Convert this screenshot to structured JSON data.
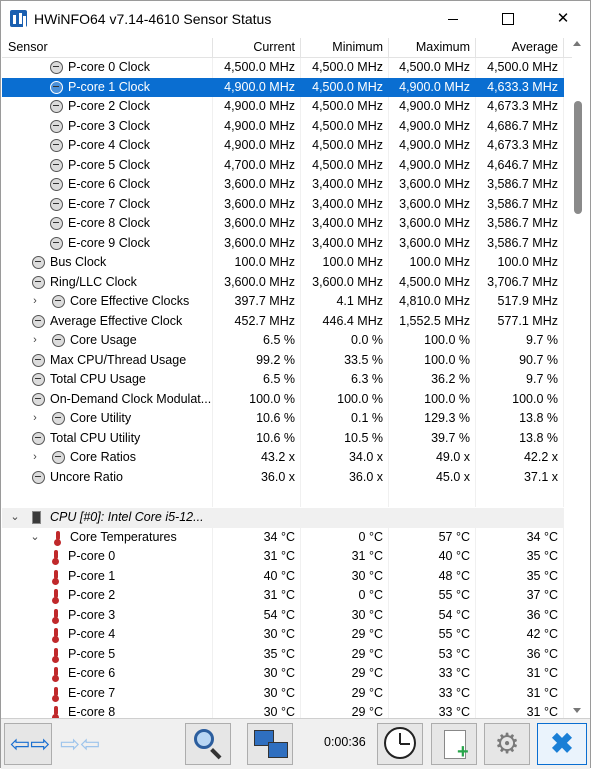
{
  "window": {
    "title": "HWiNFO64 v7.14-4610 Sensor Status"
  },
  "columns": {
    "sensor": "Sensor",
    "current": "Current",
    "minimum": "Minimum",
    "maximum": "Maximum",
    "average": "Average"
  },
  "rows": [
    {
      "name": "P-core 0 Clock",
      "cur": "4,500.0 MHz",
      "min": "4,500.0 MHz",
      "max": "4,500.0 MHz",
      "avg": "4,500.0 MHz"
    },
    {
      "name": "P-core 1 Clock",
      "cur": "4,900.0 MHz",
      "min": "4,500.0 MHz",
      "max": "4,900.0 MHz",
      "avg": "4,633.3 MHz"
    },
    {
      "name": "P-core 2 Clock",
      "cur": "4,900.0 MHz",
      "min": "4,500.0 MHz",
      "max": "4,900.0 MHz",
      "avg": "4,673.3 MHz"
    },
    {
      "name": "P-core 3 Clock",
      "cur": "4,900.0 MHz",
      "min": "4,500.0 MHz",
      "max": "4,900.0 MHz",
      "avg": "4,686.7 MHz"
    },
    {
      "name": "P-core 4 Clock",
      "cur": "4,900.0 MHz",
      "min": "4,500.0 MHz",
      "max": "4,900.0 MHz",
      "avg": "4,673.3 MHz"
    },
    {
      "name": "P-core 5 Clock",
      "cur": "4,700.0 MHz",
      "min": "4,500.0 MHz",
      "max": "4,900.0 MHz",
      "avg": "4,646.7 MHz"
    },
    {
      "name": "E-core 6 Clock",
      "cur": "3,600.0 MHz",
      "min": "3,400.0 MHz",
      "max": "3,600.0 MHz",
      "avg": "3,586.7 MHz"
    },
    {
      "name": "E-core 7 Clock",
      "cur": "3,600.0 MHz",
      "min": "3,400.0 MHz",
      "max": "3,600.0 MHz",
      "avg": "3,586.7 MHz"
    },
    {
      "name": "E-core 8 Clock",
      "cur": "3,600.0 MHz",
      "min": "3,400.0 MHz",
      "max": "3,600.0 MHz",
      "avg": "3,586.7 MHz"
    },
    {
      "name": "E-core 9 Clock",
      "cur": "3,600.0 MHz",
      "min": "3,400.0 MHz",
      "max": "3,600.0 MHz",
      "avg": "3,586.7 MHz"
    },
    {
      "name": "Bus Clock",
      "cur": "100.0 MHz",
      "min": "100.0 MHz",
      "max": "100.0 MHz",
      "avg": "100.0 MHz"
    },
    {
      "name": "Ring/LLC Clock",
      "cur": "3,600.0 MHz",
      "min": "3,600.0 MHz",
      "max": "4,500.0 MHz",
      "avg": "3,706.7 MHz"
    },
    {
      "name": "Core Effective Clocks",
      "cur": "397.7 MHz",
      "min": "4.1 MHz",
      "max": "4,810.0 MHz",
      "avg": "517.9 MHz"
    },
    {
      "name": "Average Effective Clock",
      "cur": "452.7 MHz",
      "min": "446.4 MHz",
      "max": "1,552.5 MHz",
      "avg": "577.1 MHz"
    },
    {
      "name": "Core Usage",
      "cur": "6.5 %",
      "min": "0.0 %",
      "max": "100.0 %",
      "avg": "9.7 %"
    },
    {
      "name": "Max CPU/Thread Usage",
      "cur": "99.2 %",
      "min": "33.5 %",
      "max": "100.0 %",
      "avg": "90.7 %"
    },
    {
      "name": "Total CPU Usage",
      "cur": "6.5 %",
      "min": "6.3 %",
      "max": "36.2 %",
      "avg": "9.7 %"
    },
    {
      "name": "On-Demand Clock Modulat...",
      "cur": "100.0 %",
      "min": "100.0 %",
      "max": "100.0 %",
      "avg": "100.0 %"
    },
    {
      "name": "Core Utility",
      "cur": "10.6 %",
      "min": "0.1 %",
      "max": "129.3 %",
      "avg": "13.8 %"
    },
    {
      "name": "Total CPU Utility",
      "cur": "10.6 %",
      "min": "10.5 %",
      "max": "39.7 %",
      "avg": "13.8 %"
    },
    {
      "name": "Core Ratios",
      "cur": "43.2 x",
      "min": "34.0 x",
      "max": "49.0 x",
      "avg": "42.2 x"
    },
    {
      "name": "Uncore Ratio",
      "cur": "36.0 x",
      "min": "36.0 x",
      "max": "45.0 x",
      "avg": "37.1 x"
    },
    {
      "name": "",
      "cur": "",
      "min": "",
      "max": "",
      "avg": ""
    },
    {
      "name": "CPU [#0]: Intel Core i5-12...",
      "cur": "",
      "min": "",
      "max": "",
      "avg": ""
    },
    {
      "name": "Core Temperatures",
      "cur": "34 °C",
      "min": "0 °C",
      "max": "57 °C",
      "avg": "34 °C"
    },
    {
      "name": "P-core 0",
      "cur": "31 °C",
      "min": "31 °C",
      "max": "40 °C",
      "avg": "35 °C"
    },
    {
      "name": "P-core 1",
      "cur": "40 °C",
      "min": "30 °C",
      "max": "48 °C",
      "avg": "35 °C"
    },
    {
      "name": "P-core 2",
      "cur": "31 °C",
      "min": "0 °C",
      "max": "55 °C",
      "avg": "37 °C"
    },
    {
      "name": "P-core 3",
      "cur": "54 °C",
      "min": "30 °C",
      "max": "54 °C",
      "avg": "36 °C"
    },
    {
      "name": "P-core 4",
      "cur": "30 °C",
      "min": "29 °C",
      "max": "55 °C",
      "avg": "42 °C"
    },
    {
      "name": "P-core 5",
      "cur": "35 °C",
      "min": "29 °C",
      "max": "53 °C",
      "avg": "36 °C"
    },
    {
      "name": "E-core 6",
      "cur": "30 °C",
      "min": "29 °C",
      "max": "33 °C",
      "avg": "31 °C"
    },
    {
      "name": "E-core 7",
      "cur": "30 °C",
      "min": "29 °C",
      "max": "33 °C",
      "avg": "31 °C"
    },
    {
      "name": "E-core 8",
      "cur": "30 °C",
      "min": "29 °C",
      "max": "33 °C",
      "avg": "31 °C"
    }
  ],
  "toolbar": {
    "timer": "0:00:36"
  },
  "colors": {
    "selection": "#0a6ed1",
    "accent": "#1a7fd6"
  }
}
